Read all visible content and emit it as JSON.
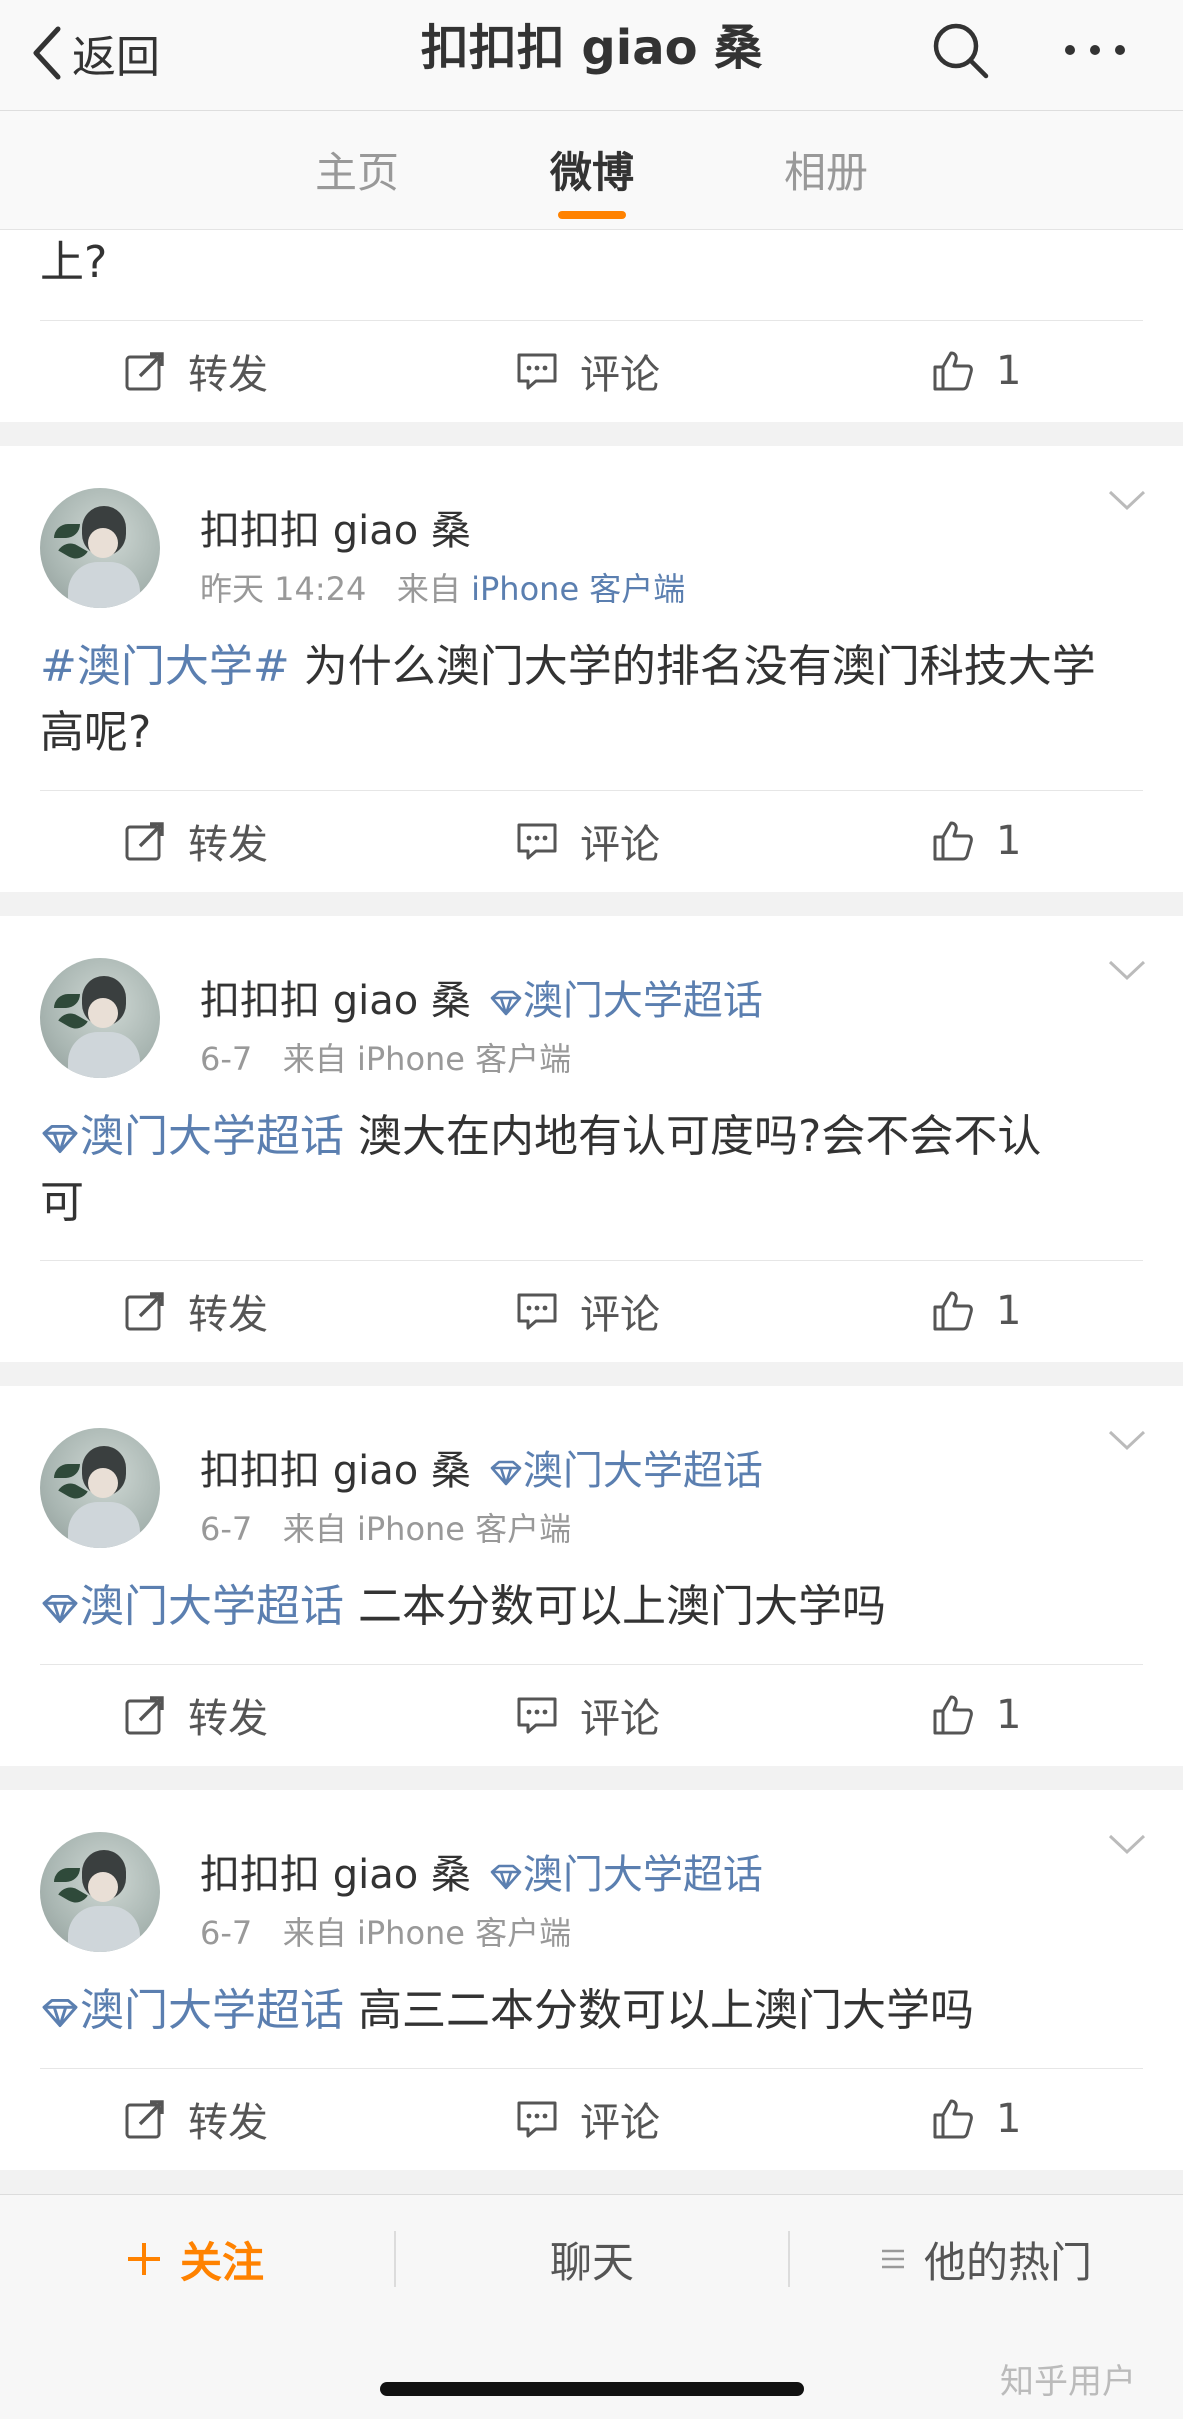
{
  "header": {
    "back_label": "返回",
    "title": "扣扣扣 giao 桑"
  },
  "tabs": [
    {
      "label": "主页",
      "active": false
    },
    {
      "label": "微博",
      "active": true
    },
    {
      "label": "相册",
      "active": false
    }
  ],
  "actions": {
    "repost_label": "转发",
    "comment_label": "评论"
  },
  "partial_post": {
    "text": "上?",
    "likes": "1"
  },
  "posts": [
    {
      "username": "扣扣扣 giao 桑",
      "badge": "",
      "time": "昨天 14:24",
      "source_prefix": "来自",
      "source": "iPhone 客户端",
      "topic": "#澳门大学#",
      "text_line1": " 为什么澳门大学的排名没有澳门科技大学",
      "text_line2": "高呢?",
      "likes": "1"
    },
    {
      "username": "扣扣扣 giao 桑",
      "badge": "澳门大学超话",
      "time": "6-7",
      "source_prefix": "来自",
      "source": "iPhone 客户端",
      "topic": "澳门大学超话",
      "text_line1": " 澳大在内地有认可度吗?会不会不认",
      "text_line2": "可",
      "likes": "1"
    },
    {
      "username": "扣扣扣 giao 桑",
      "badge": "澳门大学超话",
      "time": "6-7",
      "source_prefix": "来自",
      "source": "iPhone 客户端",
      "topic": "澳门大学超话",
      "text_line1": " 二本分数可以上澳门大学吗",
      "text_line2": "",
      "likes": "1"
    },
    {
      "username": "扣扣扣 giao 桑",
      "badge": "澳门大学超话",
      "time": "6-7",
      "source_prefix": "来自",
      "source": "iPhone 客户端",
      "topic": "澳门大学超话",
      "text_line1": " 高三二本分数可以上澳门大学吗",
      "text_line2": "",
      "likes": "1"
    }
  ],
  "bottom_bar": {
    "follow_label": "关注",
    "chat_label": "聊天",
    "hot_label": "他的热门"
  },
  "watermark": "知乎用户",
  "colors": {
    "accent": "#ff8200",
    "link": "#5b7fb0"
  }
}
